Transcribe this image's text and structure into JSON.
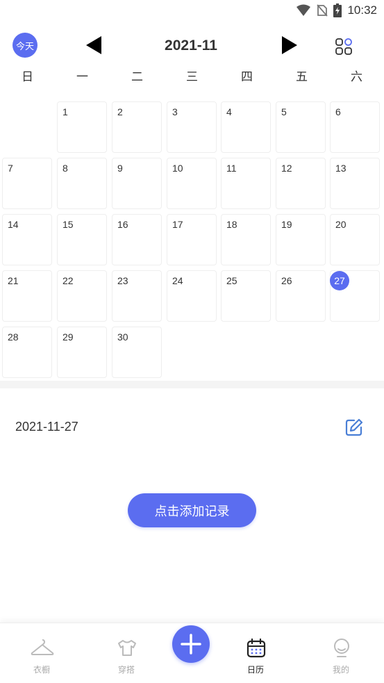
{
  "status_bar": {
    "time": "10:32"
  },
  "header": {
    "today_label": "今天",
    "month": "2021-11"
  },
  "weekdays": [
    "日",
    "一",
    "二",
    "三",
    "四",
    "五",
    "六"
  ],
  "calendar": {
    "days": [
      "1",
      "2",
      "3",
      "4",
      "5",
      "6",
      "7",
      "8",
      "9",
      "10",
      "11",
      "12",
      "13",
      "14",
      "15",
      "16",
      "17",
      "18",
      "19",
      "20",
      "21",
      "22",
      "23",
      "24",
      "25",
      "26",
      "27",
      "28",
      "29",
      "30"
    ],
    "selected_day": "27"
  },
  "record": {
    "date": "2021-11-27",
    "add_label": "点击添加记录"
  },
  "nav": {
    "items": [
      {
        "label": "衣橱",
        "icon": "hanger-icon"
      },
      {
        "label": "穿搭",
        "icon": "shirt-icon"
      },
      {
        "label": "日历",
        "icon": "calendar-icon",
        "active": true
      },
      {
        "label": "我的",
        "icon": "profile-icon"
      }
    ],
    "fab_icon": "plus-icon"
  },
  "colors": {
    "accent": "#5b6df0",
    "inactive": "#aaaaaa"
  }
}
